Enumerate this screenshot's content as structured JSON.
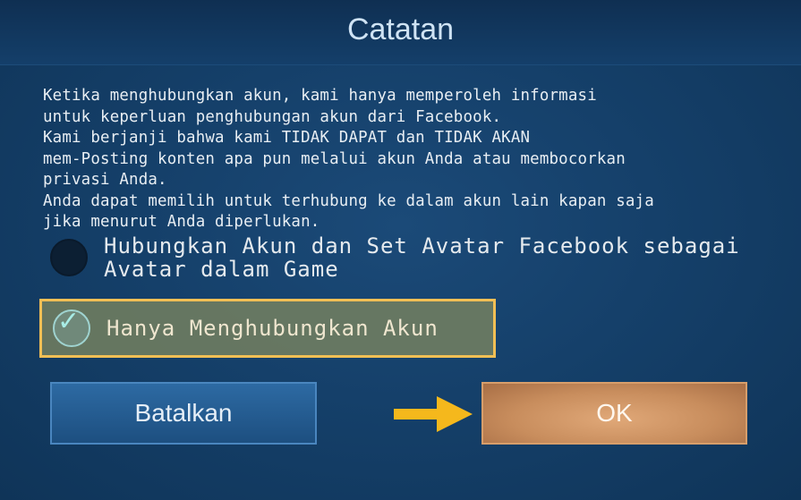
{
  "dialog": {
    "title": "Catatan",
    "message": "Ketika menghubungkan akun, kami hanya memperoleh informasi\nuntuk keperluan penghubungan akun dari Facebook.\nKami berjanji bahwa kami TIDAK DAPAT dan TIDAK AKAN\nmem-Posting konten apa pun melalui akun Anda atau membocorkan\nprivasi Anda.\nAnda dapat memilih untuk terhubung ke dalam akun lain kapan saja\njika menurut Anda diperlukan.",
    "options": [
      {
        "label": "Hubungkan Akun dan Set Avatar Facebook sebagai\nAvatar dalam Game",
        "selected": false
      },
      {
        "label": "Hanya Menghubungkan Akun",
        "selected": true
      }
    ],
    "cancel_label": "Batalkan",
    "ok_label": "OK"
  },
  "icons": {
    "check": "check-icon",
    "arrow": "arrow-right-icon"
  },
  "colors": {
    "highlight_border": "#f2bf55",
    "arrow": "#f5b81c",
    "ok_button": "#c88d5d",
    "cancel_button": "#2d6aa3"
  }
}
